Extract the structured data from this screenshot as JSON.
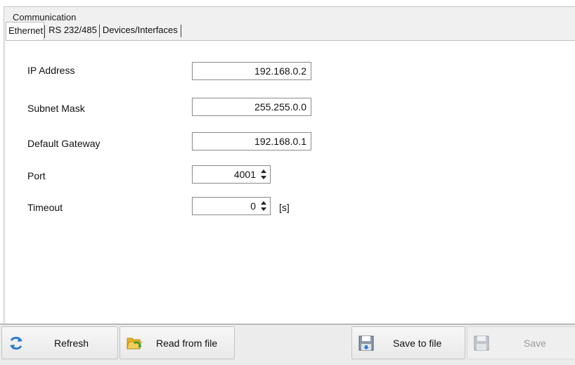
{
  "group": {
    "title": "Communication"
  },
  "tabs": [
    {
      "label": "Ethernet",
      "active": true
    },
    {
      "label": "RS 232/485",
      "active": false
    },
    {
      "label": "Devices/Interfaces",
      "active": false
    }
  ],
  "form": {
    "ip_address": {
      "label": "IP Address",
      "value": "192.168.0.2"
    },
    "subnet_mask": {
      "label": "Subnet Mask",
      "value": "255.255.0.0"
    },
    "default_gateway": {
      "label": "Default Gateway",
      "value": "192.168.0.1"
    },
    "port": {
      "label": "Port",
      "value": "4001"
    },
    "timeout": {
      "label": "Timeout",
      "value": "0",
      "unit": "[s]"
    }
  },
  "toolbar": {
    "refresh": {
      "label": "Refresh",
      "icon": "refresh-icon"
    },
    "read_from_file": {
      "label": "Read from file",
      "icon": "open-folder-icon"
    },
    "save_to_file": {
      "label": "Save to file",
      "icon": "save-to-file-icon"
    },
    "save": {
      "label": "Save",
      "icon": "floppy-disk-icon",
      "enabled": false
    }
  },
  "colors": {
    "panel_bg": "#f0f0f0",
    "content_bg": "#ffffff",
    "refresh_blue": "#2a7bd4",
    "folder_yellow": "#e8b52a"
  }
}
